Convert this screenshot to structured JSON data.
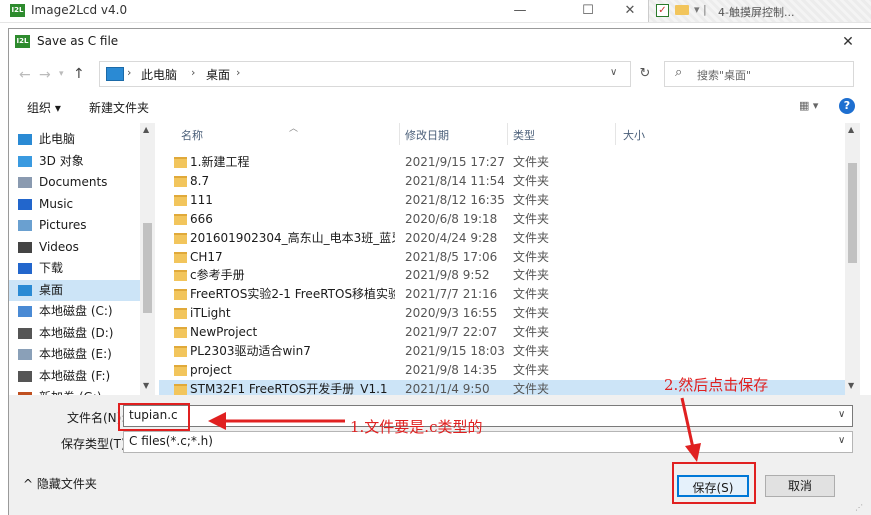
{
  "background_window": {
    "icon_text": "I2L",
    "title": "Image2Lcd v4.0",
    "minimize_glyph": "—",
    "maximize_glyph": "☐",
    "close_glyph": "✕",
    "check_glyph": "✓",
    "strip_tail": "▾ |",
    "other_tab_title": "4-触摸屏控制..."
  },
  "dialog": {
    "icon_text": "I2L",
    "title": "Save as C file",
    "close_glyph": "✕",
    "nav": {
      "back": "←",
      "forward": "→",
      "recent": "▾",
      "up": "↑"
    },
    "address": {
      "separator": "›",
      "segments": [
        "此电脑",
        "桌面"
      ],
      "dropdown": "∨"
    },
    "refresh": "↻",
    "search": {
      "icon": "⌕",
      "placeholder": "搜索\"桌面\""
    },
    "toolbar": {
      "organize": "组织 ▾",
      "new_folder": "新建文件夹",
      "view": "▦ ▾",
      "help": "?"
    },
    "nav_pane": {
      "items": [
        {
          "label": "此电脑",
          "icon": "pc-icon",
          "color": "#2a8ad4"
        },
        {
          "label": "3D 对象",
          "icon": "3d-objects-icon",
          "color": "#3a9ae0"
        },
        {
          "label": "Documents",
          "icon": "documents-icon",
          "color": "#8a9ab0"
        },
        {
          "label": "Music",
          "icon": "music-icon",
          "color": "#2266cc"
        },
        {
          "label": "Pictures",
          "icon": "pictures-icon",
          "color": "#6aa0d0"
        },
        {
          "label": "Videos",
          "icon": "videos-icon",
          "color": "#444444"
        },
        {
          "label": "下载",
          "icon": "download-icon",
          "color": "#2266cc"
        },
        {
          "label": "桌面",
          "icon": "desktop-icon",
          "color": "#2a8ad4",
          "selected": true
        },
        {
          "label": "本地磁盘 (C:)",
          "icon": "drive-c-icon",
          "color": "#4a8ad4"
        },
        {
          "label": "本地磁盘 (D:)",
          "icon": "drive-d-icon",
          "color": "#555555"
        },
        {
          "label": "本地磁盘 (E:)",
          "icon": "drive-e-icon",
          "color": "#8aa0b8"
        },
        {
          "label": "本地磁盘 (F:)",
          "icon": "drive-f-icon",
          "color": "#555555"
        },
        {
          "label": "新加卷 (G:)",
          "icon": "drive-g-icon",
          "color": "#c05020"
        }
      ],
      "scroll_up": "▲",
      "scroll_down": "▼"
    },
    "columns": {
      "name": "名称",
      "date": "修改日期",
      "type": "类型",
      "size": "大小",
      "sort_glyph": "︿"
    },
    "files": [
      {
        "name": "1.新建工程",
        "date": "2021/9/15 17:27",
        "type": "文件夹"
      },
      {
        "name": "8.7",
        "date": "2021/8/14 11:54",
        "type": "文件夹"
      },
      {
        "name": "111",
        "date": "2021/8/12 16:35",
        "type": "文件夹"
      },
      {
        "name": "666",
        "date": "2020/6/8 19:18",
        "type": "文件夹"
      },
      {
        "name": "201601902304_高东山_电本3班_蓝牙热...",
        "date": "2020/4/24 9:28",
        "type": "文件夹"
      },
      {
        "name": "CH17",
        "date": "2021/8/5 17:06",
        "type": "文件夹"
      },
      {
        "name": "c参考手册",
        "date": "2021/9/8 9:52",
        "type": "文件夹"
      },
      {
        "name": "FreeRTOS实验2-1 FreeRTOS移植实验",
        "date": "2021/7/7 21:16",
        "type": "文件夹"
      },
      {
        "name": "iTLight",
        "date": "2020/9/3 16:55",
        "type": "文件夹"
      },
      {
        "name": "NewProject",
        "date": "2021/9/7 22:07",
        "type": "文件夹"
      },
      {
        "name": "PL2303驱动适合win7",
        "date": "2021/9/15 18:03",
        "type": "文件夹"
      },
      {
        "name": "project",
        "date": "2021/9/8 14:35",
        "type": "文件夹"
      },
      {
        "name": "STM32F1 FreeRTOS开发手册_V1.1",
        "date": "2021/1/4 9:50",
        "type": "文件夹",
        "selected": true
      }
    ],
    "list_scroll": {
      "up": "▲",
      "down": "▼"
    },
    "filename": {
      "label": "文件名(N):",
      "value": "tupian.c",
      "dropdown": "∨"
    },
    "filetype": {
      "label": "保存类型(T):",
      "value": "C files(*.c;*.h)",
      "dropdown": "∨"
    },
    "hide_folders": "^ 隐藏文件夹",
    "save": "保存(S)",
    "cancel": "取消",
    "resize_grip": "⋰"
  },
  "annotations": {
    "note1": "1.文件要是.c类型的",
    "note2": "2.然后点击保存",
    "color": "#e02020"
  }
}
